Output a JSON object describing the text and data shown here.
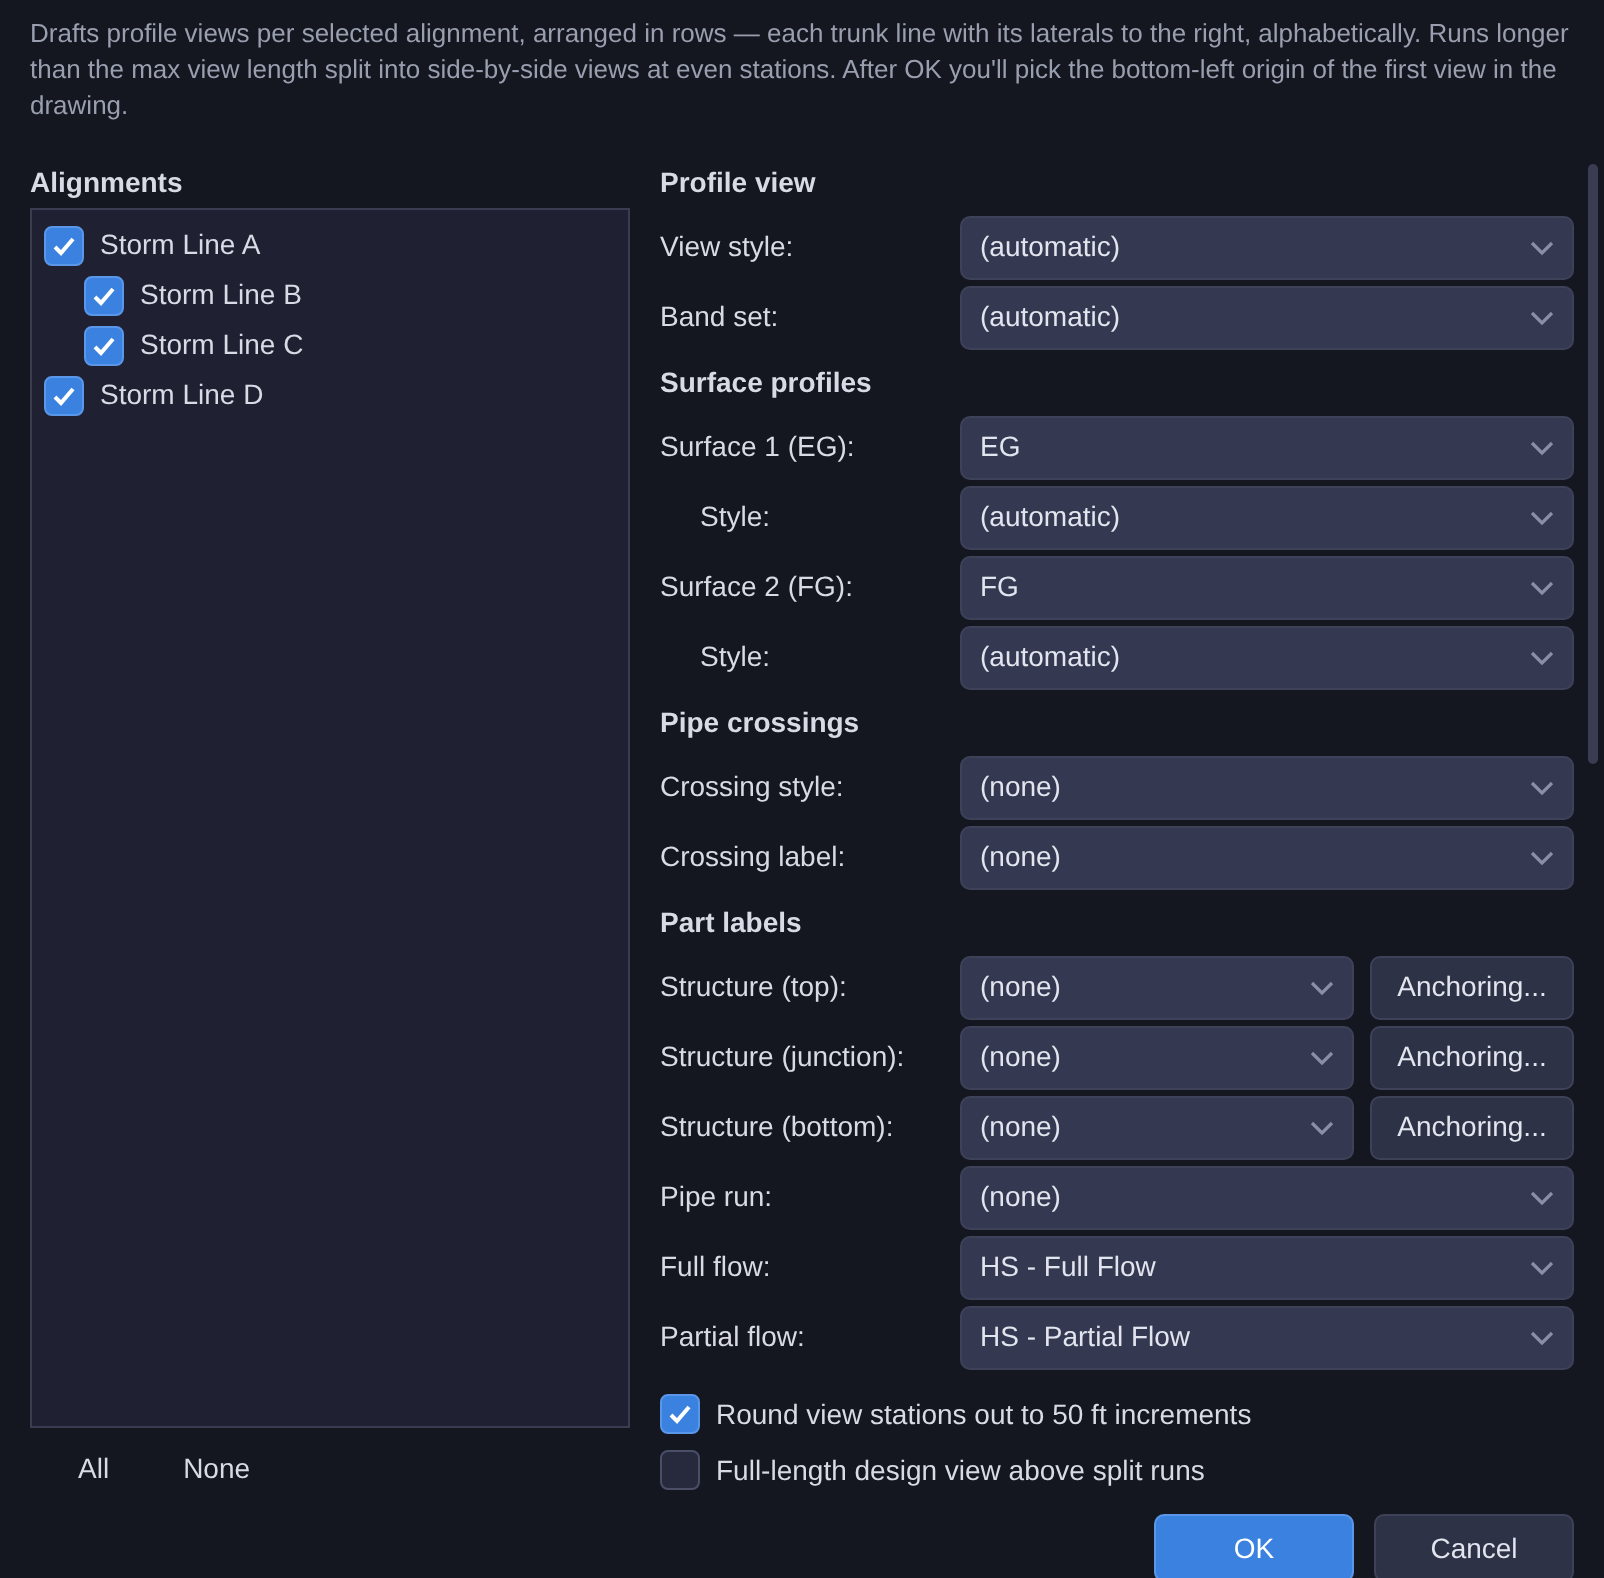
{
  "description": "Drafts profile views per selected alignment, arranged in rows — each trunk line with its laterals to the right, alphabetically. Runs longer than the max view length split into side-by-side views at even stations. After OK you'll pick the bottom-left origin of the first view in the drawing.",
  "alignments": {
    "title": "Alignments",
    "items": [
      {
        "label": "Storm Line A",
        "checked": true,
        "children": [
          {
            "label": "Storm Line B",
            "checked": true
          },
          {
            "label": "Storm Line C",
            "checked": true
          }
        ]
      },
      {
        "label": "Storm Line D",
        "checked": true
      }
    ],
    "links": [
      "All",
      "None"
    ]
  },
  "sections": [
    {
      "title": "Profile view",
      "rows": [
        {
          "kind": "select",
          "label": "View style:",
          "value": "(automatic)"
        },
        {
          "kind": "select",
          "label": "Band set:",
          "value": "(automatic)"
        }
      ]
    },
    {
      "title": "Surface profiles",
      "rows": [
        {
          "kind": "select",
          "label": "Surface 1 (EG):",
          "value": "EG",
          "children": [
            {
              "label": "Style:",
              "value": "(automatic)"
            }
          ]
        },
        {
          "kind": "select",
          "label": "Surface 2 (FG):",
          "value": "FG",
          "children": [
            {
              "label": "Style:",
              "value": "(automatic)"
            }
          ]
        }
      ]
    },
    {
      "title": "Pipe crossings",
      "rows": [
        {
          "kind": "select",
          "label": "Crossing style:",
          "value": "(none)"
        },
        {
          "kind": "select",
          "label": "Crossing label:",
          "value": "(none)"
        }
      ]
    },
    {
      "title": "Part labels",
      "rows": [
        {
          "kind": "select-button",
          "label": "Structure (top):",
          "value": "(none)",
          "button": "Anchoring..."
        },
        {
          "kind": "select-button",
          "label": "Structure (junction):",
          "value": "(none)",
          "button": "Anchoring..."
        },
        {
          "kind": "select-button",
          "label": "Structure (bottom):",
          "value": "(none)",
          "button": "Anchoring..."
        },
        {
          "kind": "select",
          "label": "Pipe run:",
          "value": "(none)"
        },
        {
          "kind": "select",
          "label": "Full flow:",
          "value": "HS - Full Flow"
        },
        {
          "kind": "select",
          "label": "Partial flow:",
          "value": "HS - Partial Flow"
        }
      ]
    }
  ],
  "options": [
    {
      "label": "Round view stations out to 50 ft increments",
      "checked": true
    },
    {
      "label": "Full-length design view above split runs",
      "checked": false
    }
  ],
  "buttons": [
    {
      "label": "OK",
      "kind": "primary"
    },
    {
      "label": "Cancel",
      "kind": "secondary"
    }
  ]
}
